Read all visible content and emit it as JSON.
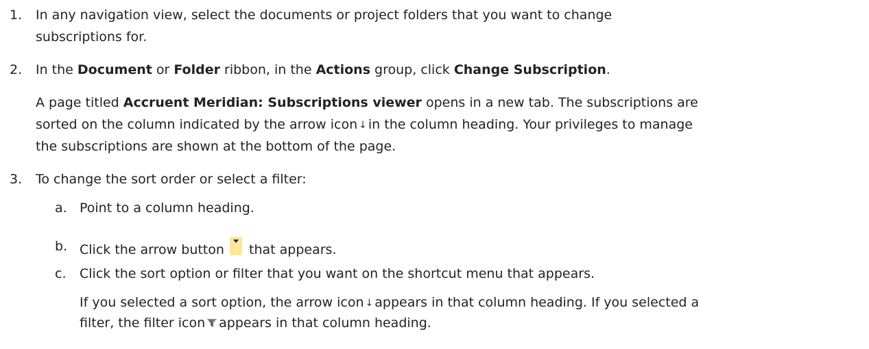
{
  "steps": [
    {
      "number": "1.",
      "line1": "In any navigation view, select the documents or project folders that you want to change",
      "line2": "subscriptions for."
    },
    {
      "number": "2.",
      "t1": "In the ",
      "b1": "Document",
      "t2": " or ",
      "b2": "Folder",
      "t3": " ribbon, in the ",
      "b3": "Actions",
      "t4": " group, click ",
      "b4": "Change Subscription",
      "t5": ".",
      "result": {
        "p1": "A page titled ",
        "b1": "Accruent Meridian: Subscriptions viewer",
        "p2": " opens in a new tab. The subscriptions are",
        "line2a": "sorted on the column indicated by the arrow icon",
        "line2b": "in the column heading. Your privileges to manage",
        "line3": "the subscriptions are shown at the bottom of the page."
      }
    },
    {
      "number": "3.",
      "text": "To change the sort order or select a filter:",
      "substeps": [
        {
          "letter": "a.",
          "text": "Point to a column heading."
        },
        {
          "letter": "b.",
          "pre": "Click the arrow button",
          "post": "that appears."
        },
        {
          "letter": "c.",
          "text": "Click the sort option or filter that you want on the shortcut menu that appears.",
          "result": {
            "l1a": "If you selected a sort option, the arrow icon",
            "l1b": "appears in that column heading. If you selected a",
            "l2a": "filter, the filter icon",
            "l2b": "appears in that column heading."
          }
        }
      ]
    }
  ],
  "icons": {
    "sort_arrow": "down-arrow-icon",
    "dropdown": "dropdown-arrow-button",
    "filter": "filter-icon",
    "button_color": "#fde89a"
  }
}
